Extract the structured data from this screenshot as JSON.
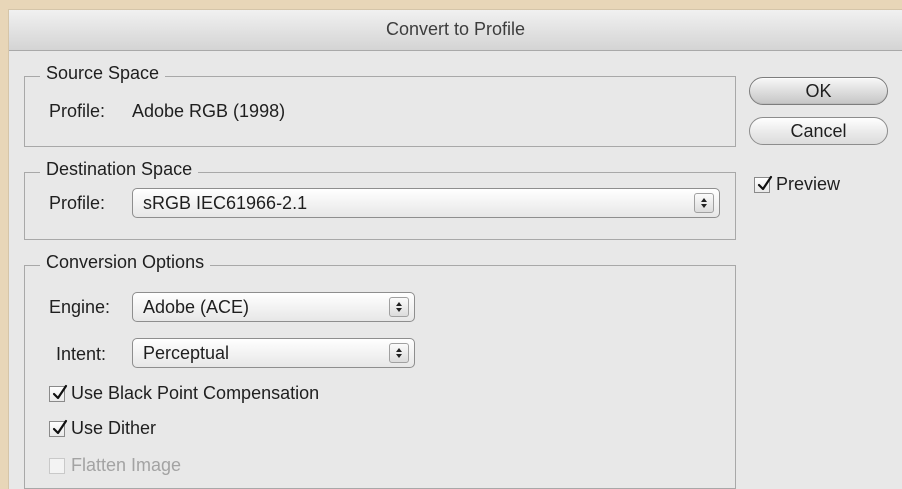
{
  "window": {
    "title": "Convert to Profile"
  },
  "source_space": {
    "label": "Source Space",
    "profile_label": "Profile:",
    "profile_value": "Adobe RGB (1998)"
  },
  "destination_space": {
    "label": "Destination Space",
    "profile_label": "Profile:",
    "profile_value": "sRGB IEC61966-2.1"
  },
  "conversion_options": {
    "label": "Conversion Options",
    "engine_label": "Engine:",
    "engine_value": "Adobe (ACE)",
    "intent_label": "Intent:",
    "intent_value": "Perceptual",
    "checkboxes": [
      {
        "label": "Use Black Point Compensation",
        "checked": true,
        "enabled": true
      },
      {
        "label": "Use Dither",
        "checked": true,
        "enabled": true
      },
      {
        "label": "Flatten Image",
        "checked": false,
        "enabled": false
      }
    ]
  },
  "buttons": {
    "ok": "OK",
    "cancel": "Cancel"
  },
  "preview": {
    "label": "Preview",
    "checked": true
  },
  "icons": {
    "checkmark": "checkmark-icon",
    "popup": "chevron-up-down-icon"
  }
}
